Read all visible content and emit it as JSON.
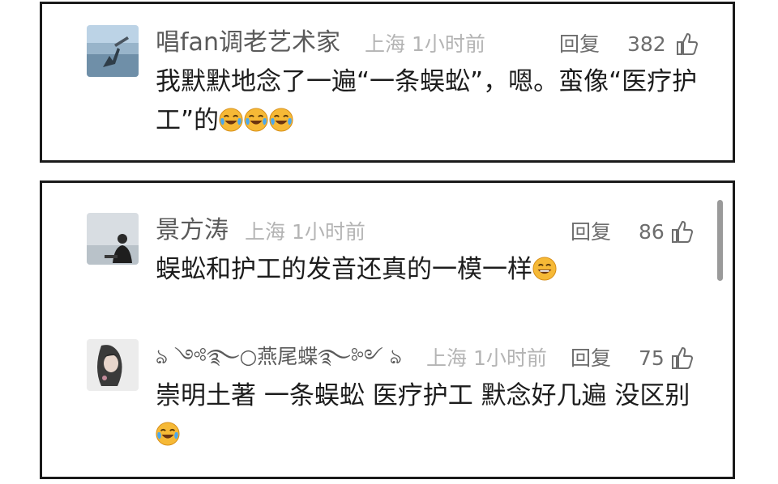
{
  "comments_top": [
    {
      "username": "唱fan调老艺术家",
      "location_time": "上海 1小时前",
      "reply_label": "回复",
      "like_count": "382",
      "text": "我默默地念了一遍“一条蜈蚣”，嗯。蛮像“医疗护工”的",
      "emoji_count": 3,
      "emoji_name": "laugh-cry-emoji"
    }
  ],
  "comments_bottom": [
    {
      "username": "景方涛",
      "location_time": "上海 1小时前",
      "reply_label": "回复",
      "like_count": "86",
      "text": "蜈蚣和护工的发音还真的一模一样",
      "emoji_count": 1,
      "emoji_name": "laugh-emoji"
    },
    {
      "username": "ঌ ༺࿐○燕尾蝶࿐༻ ঌ",
      "location_time": "上海 1小时前",
      "reply_label": "回复",
      "like_count": "75",
      "text": "崇明土著 一条蜈蚣 医疗护工 默念好几遍 没区别",
      "emoji_count": 1,
      "emoji_name": "laugh-cry-emoji"
    }
  ],
  "icons": {
    "like": "thumbs-up-icon"
  },
  "colors": {
    "border": "#1a1a1a",
    "username": "#5a5a5a",
    "meta": "#b4b4b4",
    "emoji": "#f7b733"
  }
}
